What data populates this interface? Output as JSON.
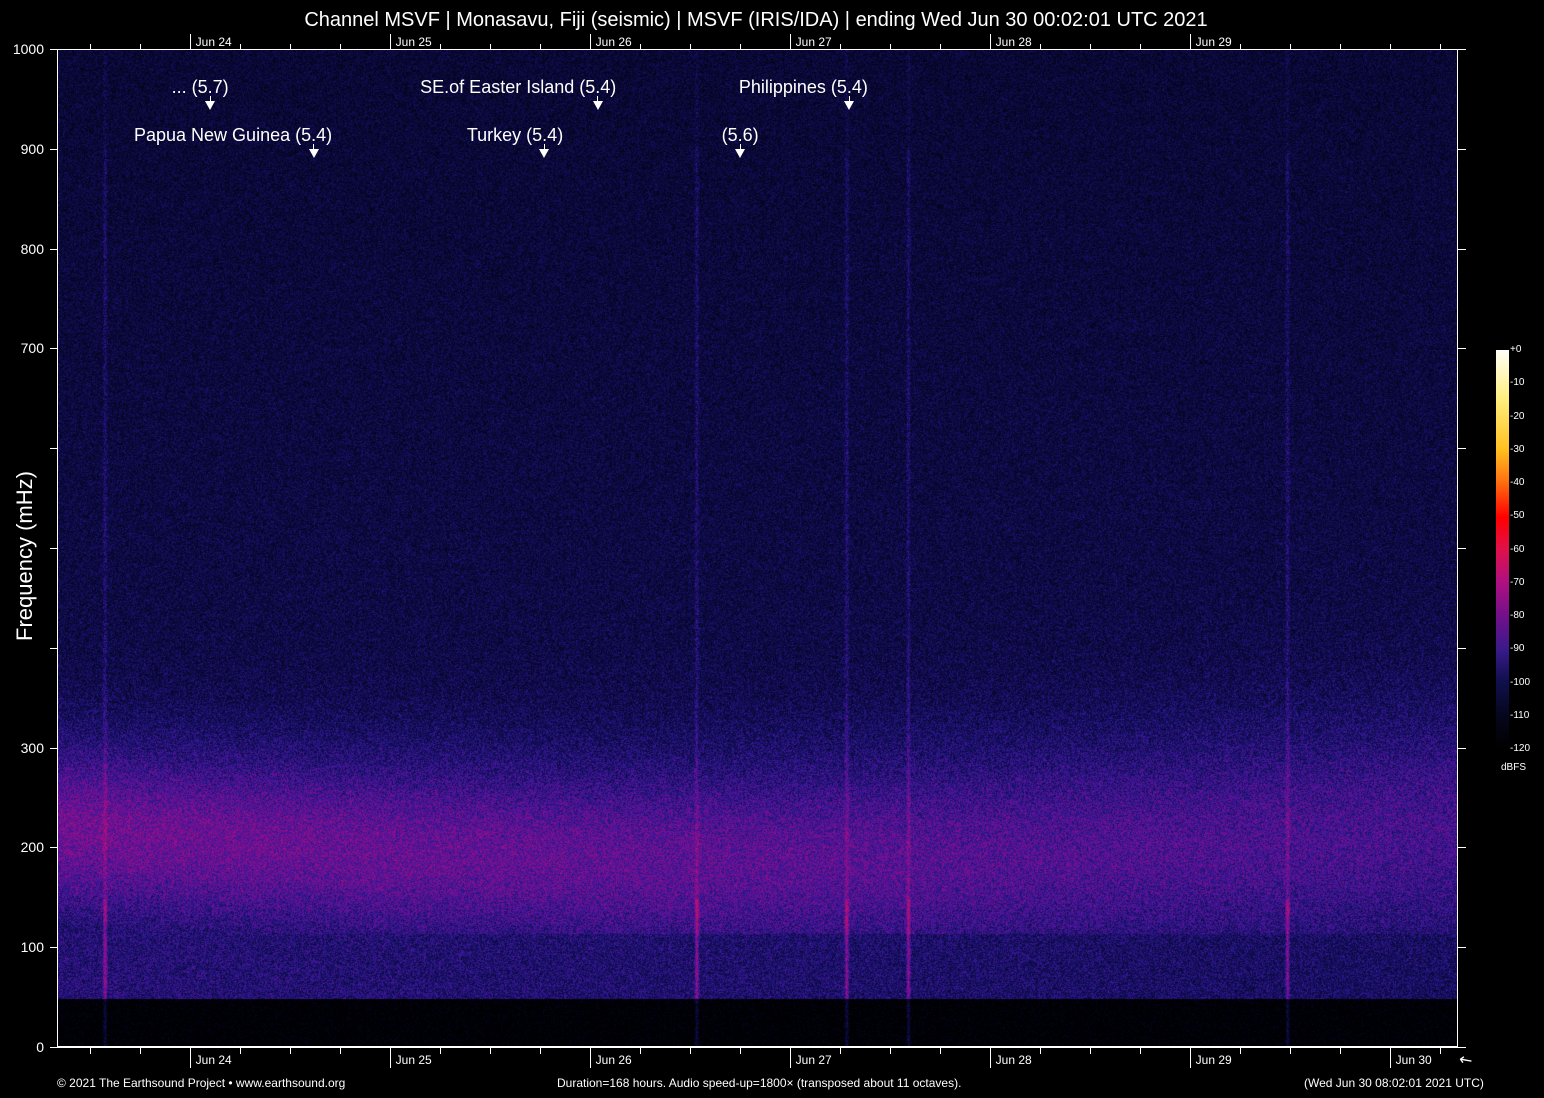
{
  "chart_data": {
    "type": "heatmap",
    "title": "Channel MSVF | Monasavu, Fiji (seismic) | MSVF (IRIS/IDA) | ending Wed Jun 30 00:02:01 UTC 2021",
    "ylabel": "Frequency (mHz)",
    "ylim": [
      0,
      1000
    ],
    "y_ticks": [
      0,
      100,
      200,
      300,
      400,
      500,
      600,
      700,
      800,
      900,
      1000
    ],
    "y_tick_labels": [
      "0",
      "100",
      "200",
      "300",
      "",
      "",
      "",
      "700",
      "800",
      "900",
      "1000"
    ],
    "x_duration_hours": 168,
    "x_tick_labels": [
      {
        "label": "Jun 24",
        "hours": 15.8
      },
      {
        "label": "Jun 25",
        "hours": 39.8
      },
      {
        "label": "Jun 26",
        "hours": 63.8
      },
      {
        "label": "Jun 27",
        "hours": 87.8
      },
      {
        "label": "Jun 28",
        "hours": 111.8
      },
      {
        "label": "Jun 29",
        "hours": 135.8
      },
      {
        "label": "Jun 30",
        "hours": 159.8
      }
    ],
    "colorbar": {
      "label": "dBFS",
      "range": [
        -120,
        0
      ],
      "ticks": [
        "+0",
        "-10",
        "-20",
        "-30",
        "-40",
        "-50",
        "-60",
        "-70",
        "-80",
        "-90",
        "-100",
        "-110",
        "-120"
      ]
    },
    "annotations": [
      {
        "text": "... (5.7)",
        "hours": 18.2
      },
      {
        "text": "Papua New Guinea (5.4)",
        "hours": 30.6
      },
      {
        "text": "SE.of Easter Island (5.4)",
        "hours": 64.7
      },
      {
        "text": "Turkey (5.4)",
        "hours": 58.3
      },
      {
        "text": "Philippines (5.4)",
        "hours": 94.9
      },
      {
        "text": "(5.6)",
        "hours": 81.8
      }
    ],
    "event_streaks_hours": [
      5.6,
      76.6,
      94.6,
      102.0,
      147.5
    ],
    "spectral_peak_mHz": 220
  },
  "footer": {
    "copyright": "© 2021 The Earthsound Project • www.earthsound.org",
    "duration": "Duration=168 hours. Audio speed-up=1800× (transposed about 11 octaves).",
    "timestamp": "(Wed Jun 30 08:02:01 2021 UTC)"
  }
}
